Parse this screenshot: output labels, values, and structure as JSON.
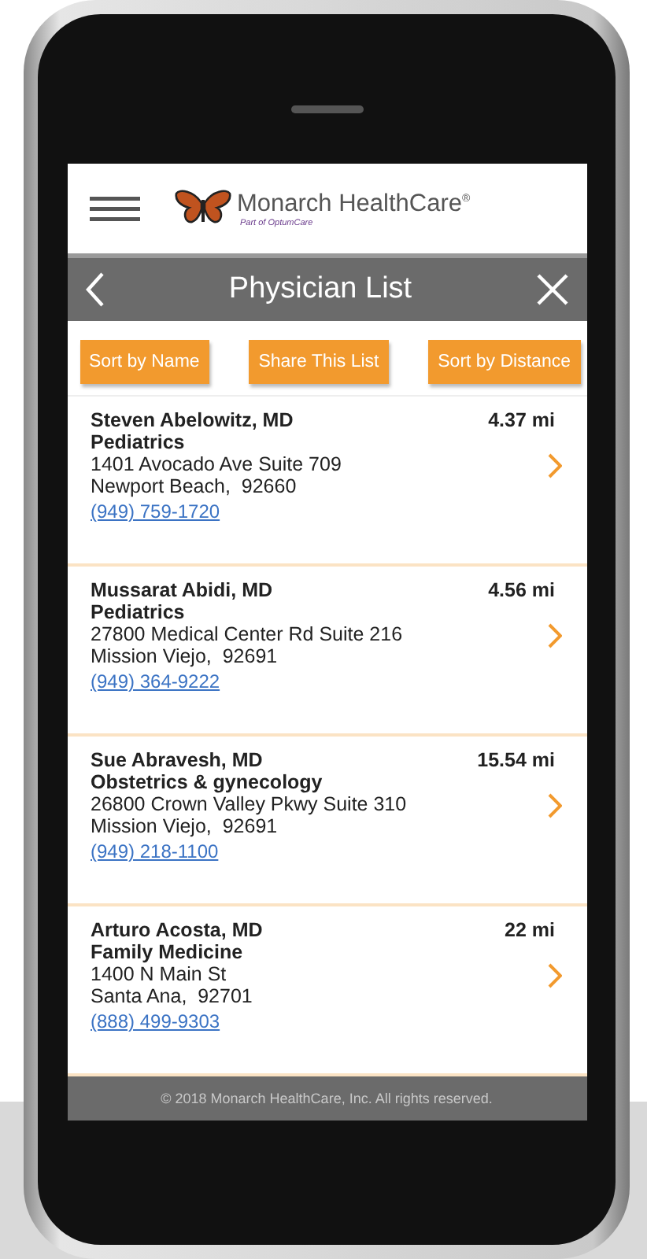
{
  "header": {
    "brand": "Monarch HealthCare$^{®}$",
    "tagline": "Part of OptumCare"
  },
  "title_bar": {
    "title": "Physician List"
  },
  "buttons": [
    "Sort by Name",
    "Share This List",
    "Sort by Distance"
  ],
  "physicians": [
    {
      "name": "Steven Abelowitz, MD",
      "specialty": "Pediatrics",
      "address": "1401 Avocado Ave Suite 709",
      "city": "Newport Beach,  92660",
      "phone": "(949) 759-1720",
      "distance": "4.37 mi"
    },
    {
      "name": "Mussarat Abidi, MD",
      "specialty": "Pediatrics",
      "address": "27800 Medical Center Rd Suite 216",
      "city": "Mission Viejo,  92691",
      "phone": "(949) 364-9222",
      "distance": "4.56 mi"
    },
    {
      "name": "Sue Abravesh, MD",
      "specialty": "Obstetrics & gynecology",
      "address": "26800 Crown Valley Pkwy Suite 310",
      "city": "Mission Viejo,  92691",
      "phone": "(949) 218-1100",
      "distance": "15.54 mi"
    },
    {
      "name": "Arturo Acosta, MD",
      "specialty": "Family Medicine",
      "address": "1400 N Main St",
      "city": "Santa Ana,  92701",
      "phone": "(888) 499-9303",
      "distance": "22 mi"
    }
  ],
  "footer": "© 2018 Monarch HealthCare, Inc. All rights reserved."
}
